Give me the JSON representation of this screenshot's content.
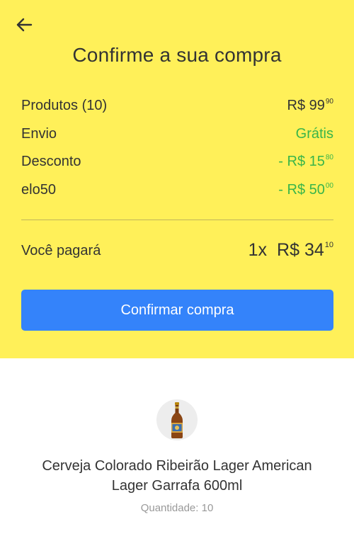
{
  "header": {
    "back_icon": "arrow-left-icon",
    "title": "Confirme a sua compra"
  },
  "summary": {
    "rows": [
      {
        "label": "Produtos (10)",
        "prefix": "R$ ",
        "amount": "99",
        "cents": "90",
        "color": "#333333"
      },
      {
        "label": "Envio",
        "prefix": "",
        "amount": "Grátis",
        "cents": "",
        "color": "#39b54a"
      },
      {
        "label": "Desconto",
        "prefix": "- R$ ",
        "amount": "15",
        "cents": "80",
        "color": "#39b54a"
      },
      {
        "label": "elo50",
        "prefix": "- R$ ",
        "amount": "50",
        "cents": "00",
        "color": "#39b54a"
      }
    ],
    "total": {
      "label": "Você pagará",
      "quantity": "1x",
      "prefix": "R$ ",
      "amount": "34",
      "cents": "10"
    }
  },
  "confirm_button": {
    "label": "Confirmar compra",
    "color": "#3483fa"
  },
  "product": {
    "image_icon": "beer-bottle-icon",
    "name": "Cerveja Colorado Ribeirão Lager American Lager Garrafa 600ml",
    "quantity": "Quantidade: 10"
  },
  "colors": {
    "header_background": "#fff059",
    "green": "#39b54a"
  }
}
